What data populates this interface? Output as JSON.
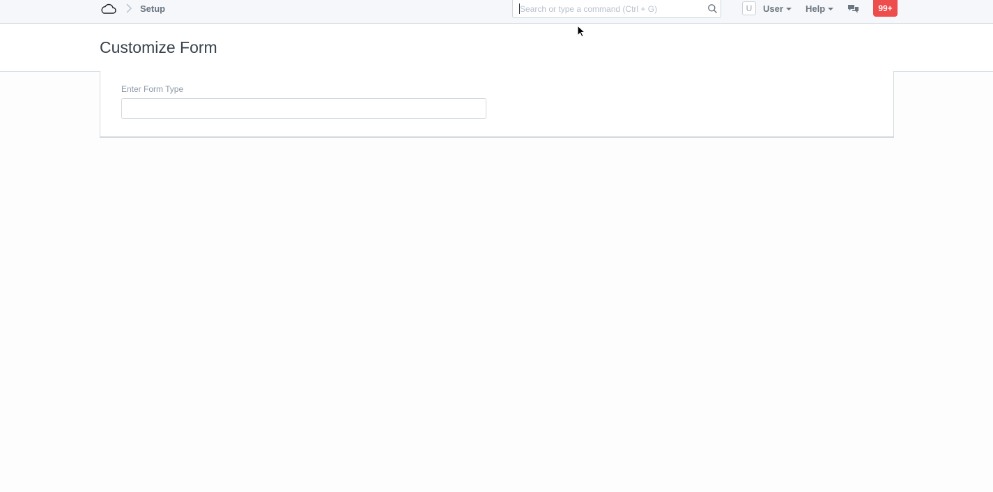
{
  "navbar": {
    "logo_icon": "cloud-icon",
    "breadcrumb": "Setup",
    "search": {
      "placeholder": "Search or type a command (Ctrl + G)",
      "value": ""
    },
    "avatar_initial": "U",
    "user_menu": "User",
    "help_menu": "Help",
    "chat_icon": "chat-icon",
    "notification_count": "99+"
  },
  "page": {
    "title": "Customize Form"
  },
  "form": {
    "field_label": "Enter Form Type",
    "field_value": ""
  },
  "colors": {
    "badge": "#ee4d4d",
    "navbar_bg": "#f5f7fa",
    "text": "#36414c",
    "muted": "#6c7680"
  }
}
